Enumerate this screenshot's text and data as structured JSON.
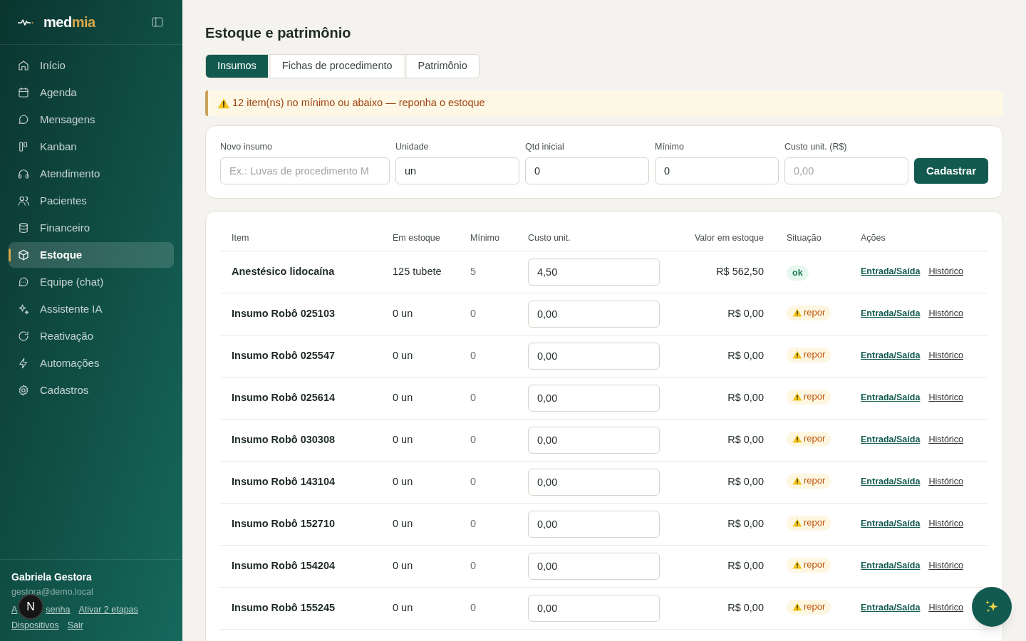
{
  "brand": {
    "name_1": "med",
    "name_2": "mia"
  },
  "sidebar": {
    "items": [
      {
        "label": "Início",
        "selected": false
      },
      {
        "label": "Agenda",
        "selected": false
      },
      {
        "label": "Mensagens",
        "selected": false
      },
      {
        "label": "Kanban",
        "selected": false
      },
      {
        "label": "Atendimento",
        "selected": false
      },
      {
        "label": "Pacientes",
        "selected": false
      },
      {
        "label": "Financeiro",
        "selected": false
      },
      {
        "label": "Estoque",
        "selected": true
      },
      {
        "label": "Equipe (chat)",
        "selected": false
      },
      {
        "label": "Assistente IA",
        "selected": false
      },
      {
        "label": "Reativação",
        "selected": false
      },
      {
        "label": "Automações",
        "selected": false
      },
      {
        "label": "Cadastros",
        "selected": false
      }
    ],
    "user": {
      "name": "Gabriela Gestora",
      "email": "gestora@demo.local",
      "covered_link": {
        "start": "A",
        "end": "senha"
      },
      "links": [
        "Ativar 2 etapas",
        "Dispositivos",
        "Sair"
      ],
      "badge": "N"
    }
  },
  "page": {
    "title": "Estoque e patrimônio"
  },
  "tabs": [
    {
      "label": "Insumos",
      "selected": true
    },
    {
      "label": "Fichas de procedimento",
      "selected": false
    },
    {
      "label": "Patrimônio",
      "selected": false
    }
  ],
  "alert": {
    "text": "12 item(ns) no mínimo ou abaixo — reponha o estoque"
  },
  "form": {
    "fields": [
      {
        "label": "Novo insumo",
        "placeholder": "Ex.: Luvas de procedimento M"
      },
      {
        "label": "Unidade",
        "value": "un"
      },
      {
        "label": "Qtd inicial",
        "value": "0"
      },
      {
        "label": "Mínimo",
        "value": "0"
      },
      {
        "label": "Custo unit. (R$)",
        "placeholder": "0,00"
      }
    ],
    "button": "Cadastrar"
  },
  "table": {
    "columns": [
      "Item",
      "Em estoque",
      "Mínimo",
      "Custo unit.",
      "Valor em estoque",
      "Situação",
      "Ações"
    ],
    "rows": [
      {
        "item": "Anestésico lidocaína",
        "stock": "125 tubete",
        "min": "5",
        "cost": "4,50",
        "value": "R$ 562,50",
        "status": {
          "kind": "ok",
          "label": "ok"
        },
        "actions": [
          "Entrada/Saída",
          "Histórico"
        ]
      },
      {
        "item": "Insumo Robô 025103",
        "stock": "0 un",
        "min": "0",
        "cost": "0,00",
        "value": "R$ 0,00",
        "status": {
          "kind": "warn",
          "label": "repor"
        },
        "actions": [
          "Entrada/Saída",
          "Histórico"
        ]
      },
      {
        "item": "Insumo Robô 025547",
        "stock": "0 un",
        "min": "0",
        "cost": "0,00",
        "value": "R$ 0,00",
        "status": {
          "kind": "warn",
          "label": "repor"
        },
        "actions": [
          "Entrada/Saída",
          "Histórico"
        ]
      },
      {
        "item": "Insumo Robô 025614",
        "stock": "0 un",
        "min": "0",
        "cost": "0,00",
        "value": "R$ 0,00",
        "status": {
          "kind": "warn",
          "label": "repor"
        },
        "actions": [
          "Entrada/Saída",
          "Histórico"
        ]
      },
      {
        "item": "Insumo Robô 030308",
        "stock": "0 un",
        "min": "0",
        "cost": "0,00",
        "value": "R$ 0,00",
        "status": {
          "kind": "warn",
          "label": "repor"
        },
        "actions": [
          "Entrada/Saída",
          "Histórico"
        ]
      },
      {
        "item": "Insumo Robô 143104",
        "stock": "0 un",
        "min": "0",
        "cost": "0,00",
        "value": "R$ 0,00",
        "status": {
          "kind": "warn",
          "label": "repor"
        },
        "actions": [
          "Entrada/Saída",
          "Histórico"
        ]
      },
      {
        "item": "Insumo Robô 152710",
        "stock": "0 un",
        "min": "0",
        "cost": "0,00",
        "value": "R$ 0,00",
        "status": {
          "kind": "warn",
          "label": "repor"
        },
        "actions": [
          "Entrada/Saída",
          "Histórico"
        ]
      },
      {
        "item": "Insumo Robô 154204",
        "stock": "0 un",
        "min": "0",
        "cost": "0,00",
        "value": "R$ 0,00",
        "status": {
          "kind": "warn",
          "label": "repor"
        },
        "actions": [
          "Entrada/Saída",
          "Histórico"
        ]
      },
      {
        "item": "Insumo Robô 155245",
        "stock": "0 un",
        "min": "0",
        "cost": "0,00",
        "value": "R$ 0,00",
        "status": {
          "kind": "warn",
          "label": "repor"
        },
        "actions": [
          "Entrada/Saída",
          "Histórico"
        ]
      }
    ]
  }
}
